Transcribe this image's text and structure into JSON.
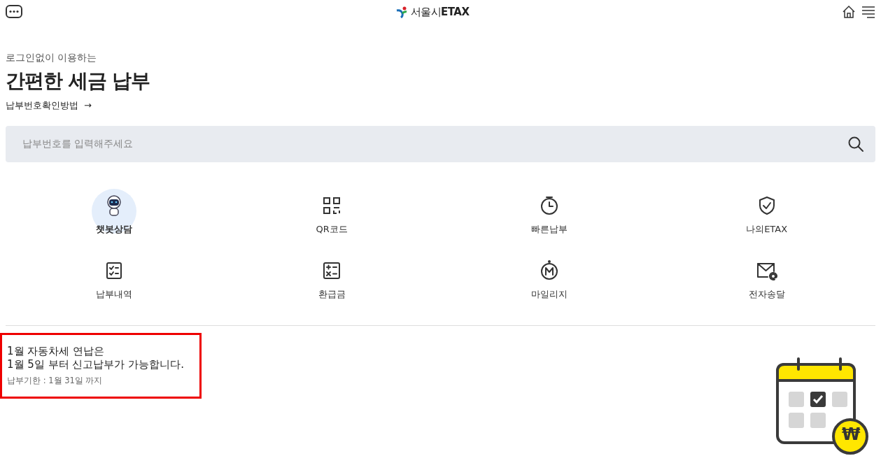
{
  "header": {
    "logo": "서울시**ETAX**"
  },
  "intro": {
    "subtitle": "로그인없이 이용하는",
    "title": "간편한 세금 납부",
    "help_link": "납부번호확인방법",
    "help_arrow": "→"
  },
  "search": {
    "placeholder": "납부번호를 입력해주세요"
  },
  "menu": [
    {
      "kind": "chatbot",
      "label": "챗봇상담",
      "selected": true
    },
    {
      "kind": "qr",
      "label": "QR코드",
      "selected": false
    },
    {
      "kind": "clock",
      "label": "빠른납부",
      "selected": false
    },
    {
      "kind": "shield",
      "label": "나의ETAX",
      "selected": false
    },
    {
      "kind": "checklist",
      "label": "납부내역",
      "selected": false
    },
    {
      "kind": "calculator",
      "label": "환급금",
      "selected": false
    },
    {
      "kind": "mileage",
      "label": "마일리지",
      "selected": false
    },
    {
      "kind": "mail",
      "label": "전자송달",
      "selected": false
    }
  ],
  "notice": {
    "lines": [
      "1월 자동차세 연납은",
      "1월 5일 부터 신고납부가 가능합니다."
    ],
    "deadline": "납부기한 : 1월 31일 까지",
    "coin_symbol": "₩"
  }
}
